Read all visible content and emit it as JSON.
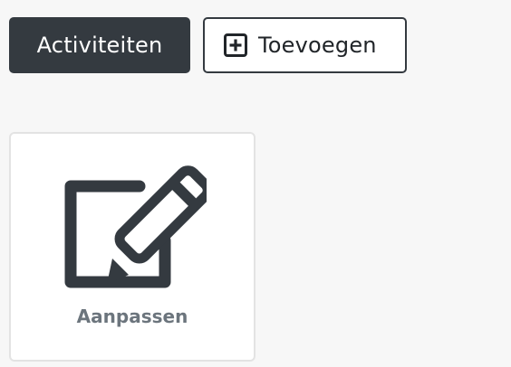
{
  "toolbar": {
    "activities_label": "Activiteiten",
    "add_label": "Toevoegen"
  },
  "card": {
    "label": "Aanpassen",
    "icon": "edit-icon"
  },
  "colors": {
    "page_background": "#f7f7f7",
    "dark_button": "#343a40",
    "card_label": "#6c757d",
    "card_border": "#e3e3e3"
  }
}
